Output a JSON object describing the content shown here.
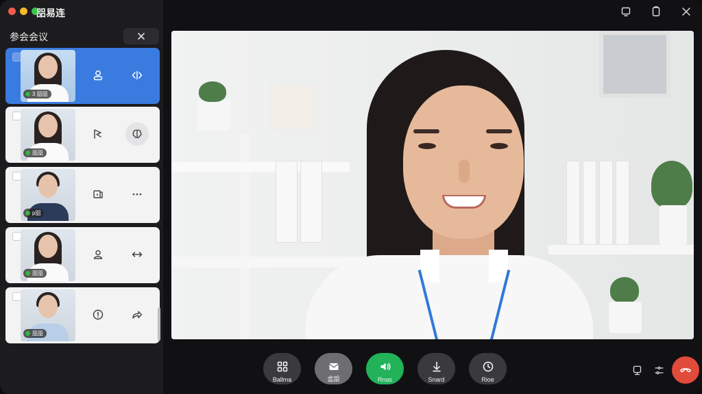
{
  "window": {
    "app_title": "㗊易连"
  },
  "sidebar": {
    "section_title": "参会会议",
    "close_icon": "close-icon",
    "participants": [
      {
        "name": "3 㗊㗊",
        "active": true,
        "buttons": [
          "person-icon",
          "code-arrows-icon"
        ]
      },
      {
        "name": "㗊㗊",
        "active": false,
        "buttons": [
          "pointer-arrow-icon",
          "brain-icon"
        ]
      },
      {
        "name": "p㗊",
        "active": false,
        "buttons": [
          "screen-share-icon",
          "more-icon"
        ]
      },
      {
        "name": "㗊㗊",
        "active": false,
        "buttons": [
          "user-switch-icon",
          "swap-icon"
        ]
      },
      {
        "name": "㗊㗊",
        "active": false,
        "buttons": [
          "info-icon",
          "forward-icon"
        ]
      }
    ]
  },
  "topbar": {
    "icons": [
      "minimize-window-icon",
      "maximize-window-icon",
      "close-window-icon"
    ]
  },
  "controls": [
    {
      "key": "layout",
      "label": "Ballma",
      "icon": "grid-icon",
      "style": "dark"
    },
    {
      "key": "chat",
      "label": "盒㗊",
      "icon": "chat-icon",
      "style": "light"
    },
    {
      "key": "audio",
      "label": "Rnas",
      "icon": "speaker-icon",
      "style": "green"
    },
    {
      "key": "download",
      "label": "Snard",
      "icon": "download-icon",
      "style": "dark"
    },
    {
      "key": "record",
      "label": "Rioe",
      "icon": "record-icon",
      "style": "dark"
    }
  ],
  "bottom_right": {
    "icons": [
      "device-icon",
      "settings-icon"
    ],
    "end_call": "end-call-icon"
  },
  "colors": {
    "accent_blue": "#3a7be0",
    "audio_green": "#21b25a",
    "end_red": "#e14b3b"
  }
}
